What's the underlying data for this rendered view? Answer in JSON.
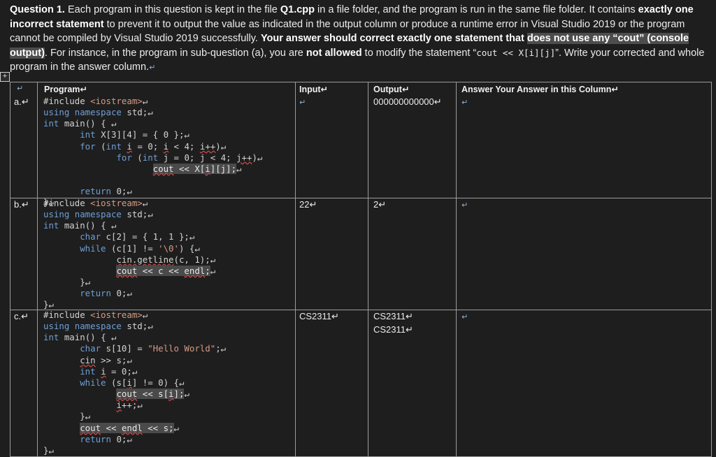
{
  "question": {
    "title": "Question 1.",
    "p1": " Each program in this question is kept in the file ",
    "file": "Q1.cpp",
    "p2": " in a file folder, and the program is run in the same file folder. It contains ",
    "bold1": "exactly one incorrect statement",
    "p3": " to prevent it to output the value as indicated in the output column or produce a runtime error in Visual Studio 2019 or the program cannot be compiled by Visual Studio 2019 successfully. ",
    "bold2": "Your answer should correct exactly one statement that ",
    "hl": "does not use any “cout” (console output)",
    "p4": ". For instance, in the program in sub-question (a), you are ",
    "bold3": "not allowed",
    "p5": " to modify the statement “",
    "code": "cout << X[i][j]",
    "p6": "”.   Write your corrected and whole program in the answer column.",
    "mark": "↵"
  },
  "table": {
    "headers": {
      "program": "Program↵",
      "input": "Input↵",
      "output": "Output↵",
      "answer": "Answer Your Answer in this Column↵"
    },
    "rows": [
      {
        "label": "a.↵",
        "input": "↵",
        "output": "000000000000↵",
        "answer": "↵"
      },
      {
        "label": "b.↵",
        "input": "22↵",
        "output": "2↵",
        "answer": "↵"
      },
      {
        "label": "c.↵",
        "input": "CS2311↵",
        "output_lines": [
          "CS2311↵",
          "CS2311↵"
        ],
        "answer": "↵"
      }
    ],
    "corner_mark": "↵"
  }
}
